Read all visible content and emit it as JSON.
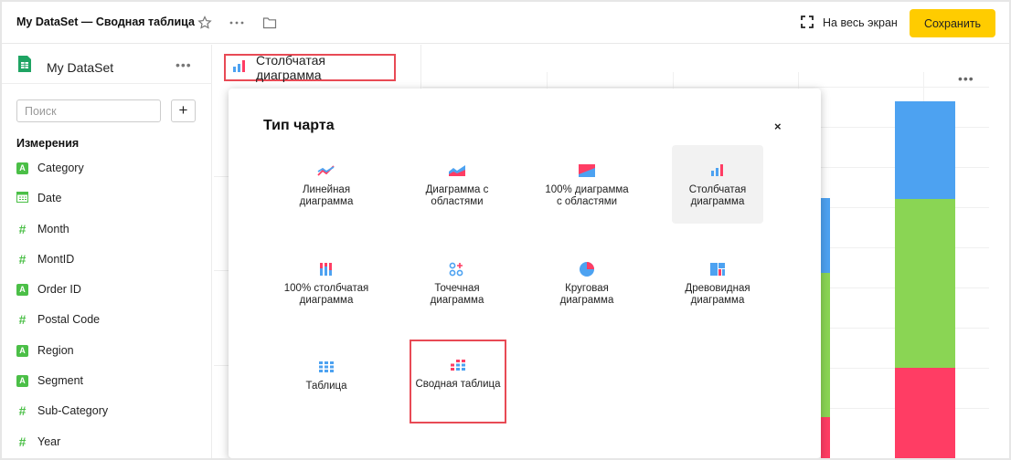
{
  "header": {
    "title": "My DataSet — Сводная таблица",
    "fullscreen_label": "На весь экран",
    "save_label": "Сохранить"
  },
  "sidebar": {
    "dataset_name": "My DataSet",
    "search_placeholder": "Поиск",
    "add_label": "+",
    "section_title": "Измерения",
    "fields": [
      {
        "name": "Category",
        "type": "string"
      },
      {
        "name": "Date",
        "type": "date"
      },
      {
        "name": "Month",
        "type": "number"
      },
      {
        "name": "MontID",
        "type": "number"
      },
      {
        "name": "Order ID",
        "type": "string"
      },
      {
        "name": "Postal Code",
        "type": "number"
      },
      {
        "name": "Region",
        "type": "string"
      },
      {
        "name": "Segment",
        "type": "string"
      },
      {
        "name": "Sub-Category",
        "type": "number"
      },
      {
        "name": "Year",
        "type": "number"
      }
    ]
  },
  "chart_type_selector": {
    "label": "Столбчатая диаграмма"
  },
  "modal": {
    "title": "Тип чарта",
    "close_label": "×",
    "types": [
      {
        "id": "line",
        "label": "Линейная диаграмма",
        "icon": "line-chart-icon"
      },
      {
        "id": "area",
        "label": "Диаграмма с областями",
        "icon": "area-chart-icon"
      },
      {
        "id": "area100",
        "label": "100% диаграмма с областями",
        "icon": "area100-chart-icon"
      },
      {
        "id": "column",
        "label": "Столбчатая диаграмма",
        "icon": "column-chart-icon",
        "selected": true
      },
      {
        "id": "column100",
        "label": "100% столбчатая диаграмма",
        "icon": "column100-chart-icon"
      },
      {
        "id": "scatter",
        "label": "Точечная диаграмма",
        "icon": "scatter-chart-icon"
      },
      {
        "id": "pie",
        "label": "Круговая диаграмма",
        "icon": "pie-chart-icon"
      },
      {
        "id": "treemap",
        "label": "Древовидная диаграмма",
        "icon": "treemap-chart-icon"
      },
      {
        "id": "table",
        "label": "Таблица",
        "icon": "table-icon"
      },
      {
        "id": "pivot",
        "label": "Сводная таблица",
        "icon": "pivot-table-icon",
        "highlighted": true
      }
    ]
  },
  "colors": {
    "accent_yellow": "#ffcc00",
    "highlight_red": "#e84a55",
    "field_green": "#4bbf47",
    "series_blue": "#4da2f1",
    "series_green": "#8ad554",
    "series_red": "#ff3d64"
  }
}
